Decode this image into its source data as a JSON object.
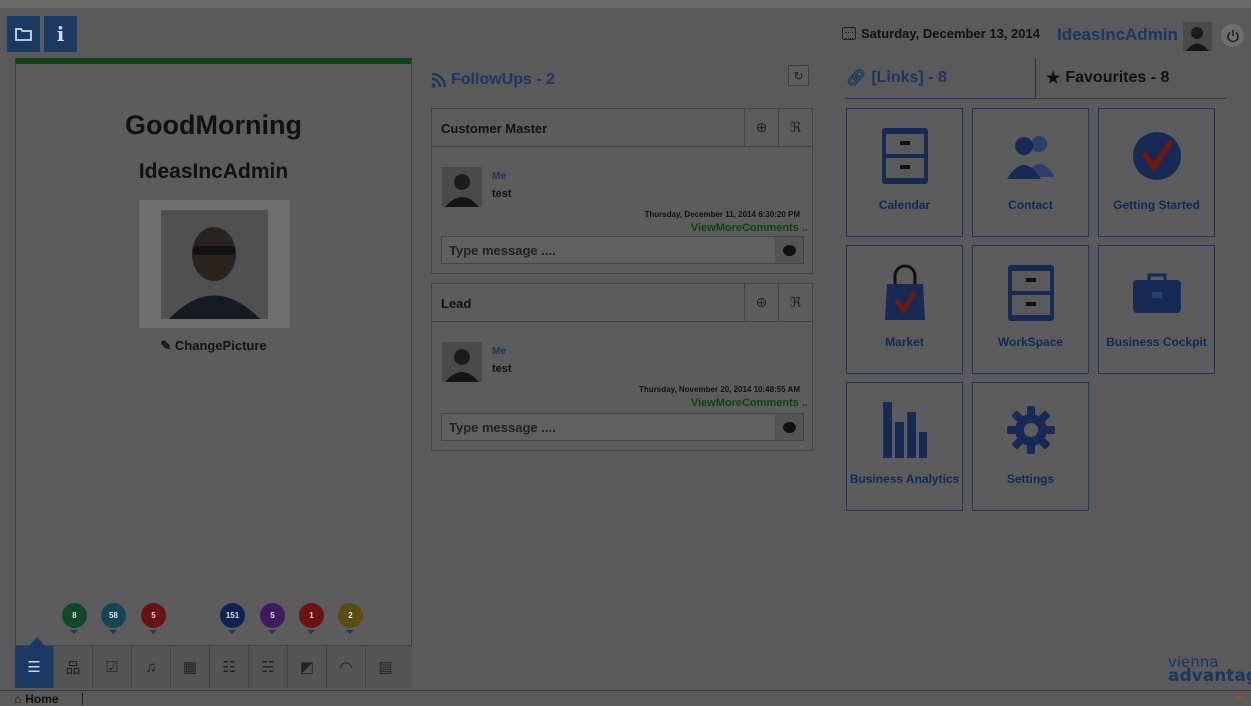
{
  "topbar": {
    "folder_icon": "folder-icon",
    "info_label": "i",
    "date": "Saturday, December 13, 2014",
    "username": "IdeasIncAdmin"
  },
  "profile": {
    "greeting": "GoodMorning",
    "username": "IdeasIncAdmin",
    "change_picture": "ChangePicture"
  },
  "badges": [
    {
      "count": "8",
      "color": "#0e4a2a"
    },
    {
      "count": "58",
      "color": "#16425a"
    },
    {
      "count": "5",
      "color": "#6a1212"
    },
    {
      "count": "151",
      "color": "#0f2258"
    },
    {
      "count": "5",
      "color": "#3e1a5c"
    },
    {
      "count": "1",
      "color": "#6a1212"
    },
    {
      "count": "2",
      "color": "#5a4c12"
    }
  ],
  "followups": {
    "title": "FollowUps - 2",
    "items": [
      {
        "title": "Customer Master",
        "who": "Me",
        "message": "test",
        "date": "Thursday, December 11, 2014 6:30:20 PM",
        "more": "ViewMoreComments ..",
        "placeholder": "Type message ...."
      },
      {
        "title": "Lead",
        "who": "Me",
        "message": "test",
        "date": "Thursday, November 20, 2014 10:48:55 AM",
        "more": "ViewMoreComments ..",
        "placeholder": "Type message ...."
      }
    ]
  },
  "links": {
    "links_tab": "[Links] - 8",
    "favourites_tab": "Favourites - 8",
    "tiles": [
      {
        "label": "Calendar",
        "icon": "calendar-cabinet-icon"
      },
      {
        "label": "Contact",
        "icon": "contact-people-icon"
      },
      {
        "label": "Getting Started",
        "icon": "checkmark-circle-icon"
      },
      {
        "label": "Market",
        "icon": "shopping-bag-icon"
      },
      {
        "label": "WorkSpace",
        "icon": "workspace-cabinet-icon"
      },
      {
        "label": "Business Cockpit",
        "icon": "briefcase-icon"
      },
      {
        "label": "Business Analytics",
        "icon": "bar-chart-icon"
      },
      {
        "label": "Settings",
        "icon": "gear-icon"
      }
    ]
  },
  "statusbar": {
    "home": "Home"
  },
  "logo": {
    "line1": "vienna",
    "line2": "advantage"
  }
}
